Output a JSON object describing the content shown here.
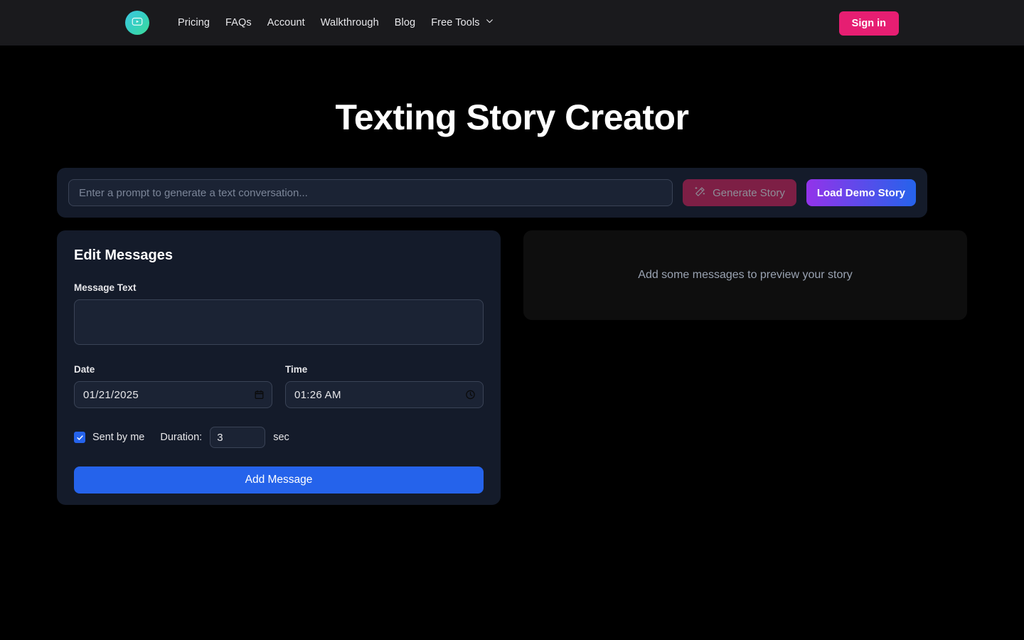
{
  "navbar": {
    "logo_icon": "play-video-logo-icon",
    "links": [
      {
        "label": "Pricing"
      },
      {
        "label": "FAQs"
      },
      {
        "label": "Account"
      },
      {
        "label": "Walkthrough"
      },
      {
        "label": "Blog"
      }
    ],
    "dropdown": {
      "label": "Free Tools",
      "icon": "chevron-down-icon"
    },
    "signin_label": "Sign in",
    "colors": {
      "signin_bg": "#e61e72",
      "nav_bg": "#1a1a1d"
    }
  },
  "page": {
    "title": "Texting Story Creator",
    "background": "#000000"
  },
  "prompt_bar": {
    "input_value": "",
    "input_placeholder": "Enter a prompt to generate a text conversation...",
    "generate_label": "Generate Story",
    "generate_icon": "magic-wand-icon",
    "generate_disabled": true,
    "demo_label": "Load Demo Story",
    "colors": {
      "generate_bg": "#7d1f45",
      "demo_gradient_start": "#9333ea",
      "demo_gradient_end": "#2563eb"
    }
  },
  "editor": {
    "heading": "Edit Messages",
    "message_text": {
      "label": "Message Text",
      "value": "",
      "placeholder": ""
    },
    "date": {
      "label": "Date",
      "value": "01/21/2025",
      "icon": "calendar-icon"
    },
    "time": {
      "label": "Time",
      "value": "01:26 AM",
      "icon": "clock-icon"
    },
    "sent_by_me": {
      "label": "Sent by me",
      "checked": true
    },
    "duration": {
      "label": "Duration:",
      "value": "3",
      "unit": "sec"
    },
    "add_message_label": "Add Message",
    "colors": {
      "panel_bg": "#141b2a",
      "accent_blue": "#2563eb"
    }
  },
  "preview": {
    "empty_text": "Add some messages to preview your story",
    "background": "#0e0e0e"
  }
}
